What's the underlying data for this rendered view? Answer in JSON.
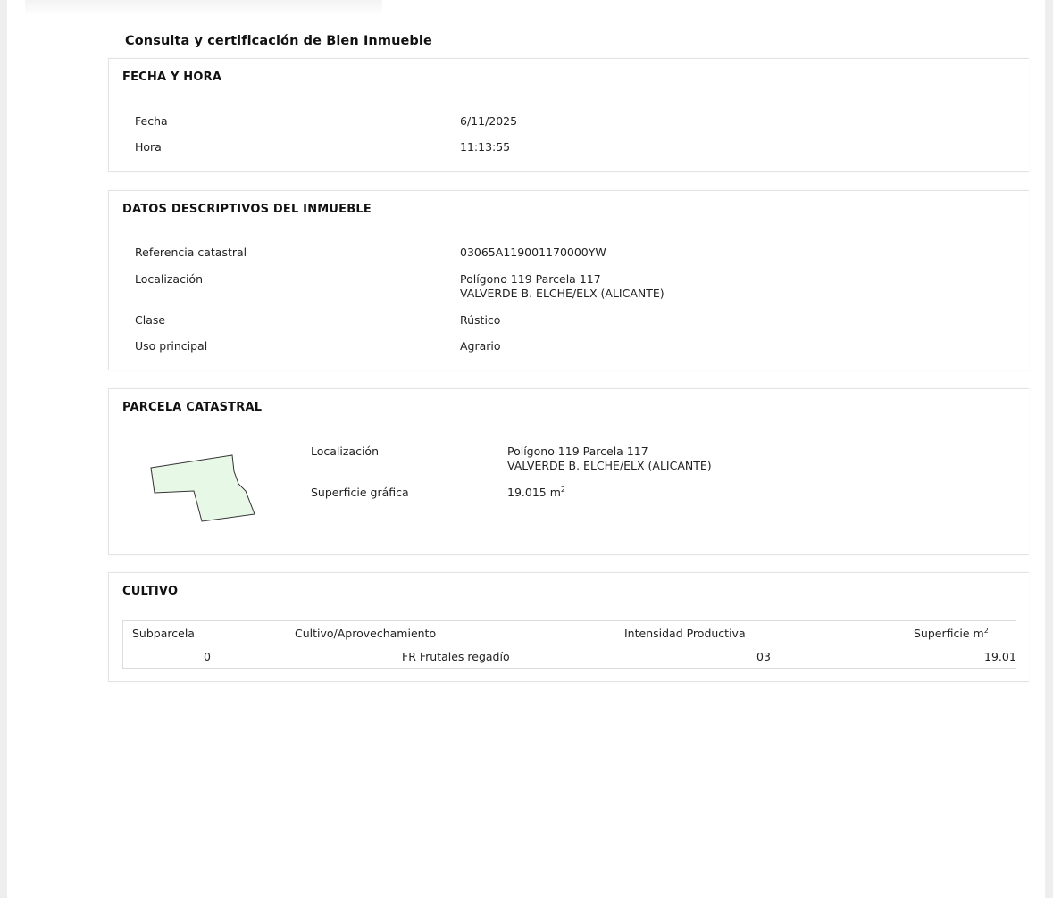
{
  "document": {
    "title": "Consulta y certificación de Bien Inmueble"
  },
  "fecha_hora": {
    "title": "FECHA Y HORA",
    "fecha_label": "Fecha",
    "fecha_value": "6/11/2025",
    "hora_label": "Hora",
    "hora_value": "11:13:55"
  },
  "datos": {
    "title": "DATOS DESCRIPTIVOS DEL INMUEBLE",
    "referencia_label": "Referencia catastral",
    "referencia_value": "03065A119001170000YW",
    "localizacion_label": "Localización",
    "localizacion_line1": "Polígono 119 Parcela 117",
    "localizacion_line2": "VALVERDE B. ELCHE/ELX (ALICANTE)",
    "clase_label": "Clase",
    "clase_value": "Rústico",
    "uso_label": "Uso principal",
    "uso_value": "Agrario"
  },
  "parcela": {
    "title": "PARCELA CATASTRAL",
    "localizacion_label": "Localización",
    "localizacion_line1": "Polígono 119 Parcela 117",
    "localizacion_line2": "VALVERDE B. ELCHE/ELX (ALICANTE)",
    "superficie_label": "Superficie gráfica",
    "superficie_value": "19.015 m",
    "superficie_exp": "2",
    "shape_fill": "#e8f8e6",
    "shape_stroke": "#333333"
  },
  "cultivo": {
    "title": "CULTIVO",
    "headers": {
      "subparcela": "Subparcela",
      "cultivo": "Cultivo/Aprovechamiento",
      "intensidad": "Intensidad Productiva",
      "superficie": "Superficie m",
      "superficie_exp": "2"
    },
    "rows": [
      {
        "subparcela": "0",
        "cultivo": "FR Frutales regadío",
        "intensidad": "03",
        "superficie": "19.01"
      }
    ]
  }
}
